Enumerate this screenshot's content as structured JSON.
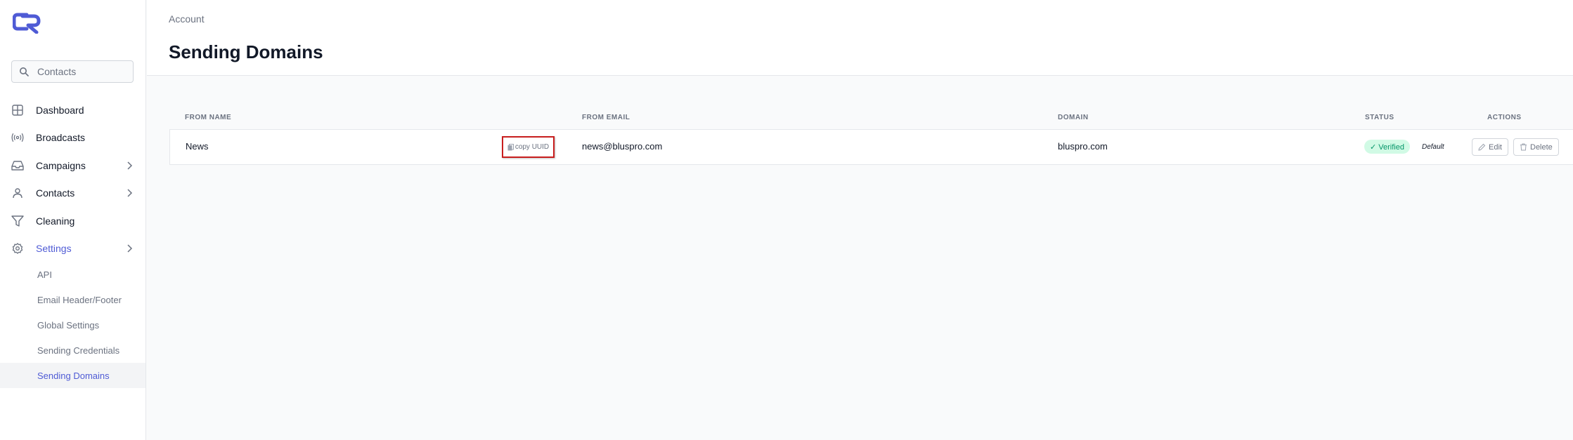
{
  "sidebar": {
    "search_placeholder": "Contacts",
    "items": [
      {
        "label": "Dashboard",
        "icon": "grid-icon"
      },
      {
        "label": "Broadcasts",
        "icon": "broadcast-icon"
      },
      {
        "label": "Campaigns",
        "icon": "inbox-icon"
      },
      {
        "label": "Contacts",
        "icon": "user-icon"
      },
      {
        "label": "Cleaning",
        "icon": "filter-icon"
      },
      {
        "label": "Settings",
        "icon": "gear-icon"
      }
    ],
    "sub_items": [
      "API",
      "Email Header/Footer",
      "Global Settings",
      "Sending Credentials",
      "Sending Domains"
    ]
  },
  "header": {
    "breadcrumb": "Account",
    "title": "Sending Domains"
  },
  "table": {
    "columns": [
      "FROM NAME",
      "FROM EMAIL",
      "DOMAIN",
      "STATUS",
      "ACTIONS"
    ],
    "rows": [
      {
        "from_name": "News",
        "copy_label": "copy UUID",
        "from_email": "news@bluspro.com",
        "domain": "bluspro.com",
        "status": "✓ Verified",
        "default_label": "Default",
        "edit_label": "Edit",
        "delete_label": "Delete"
      }
    ]
  },
  "colors": {
    "accent": "#4f5bd5",
    "verified_bg": "#d1fae5",
    "verified_text": "#059669",
    "highlight_border": "#c81e1e"
  }
}
